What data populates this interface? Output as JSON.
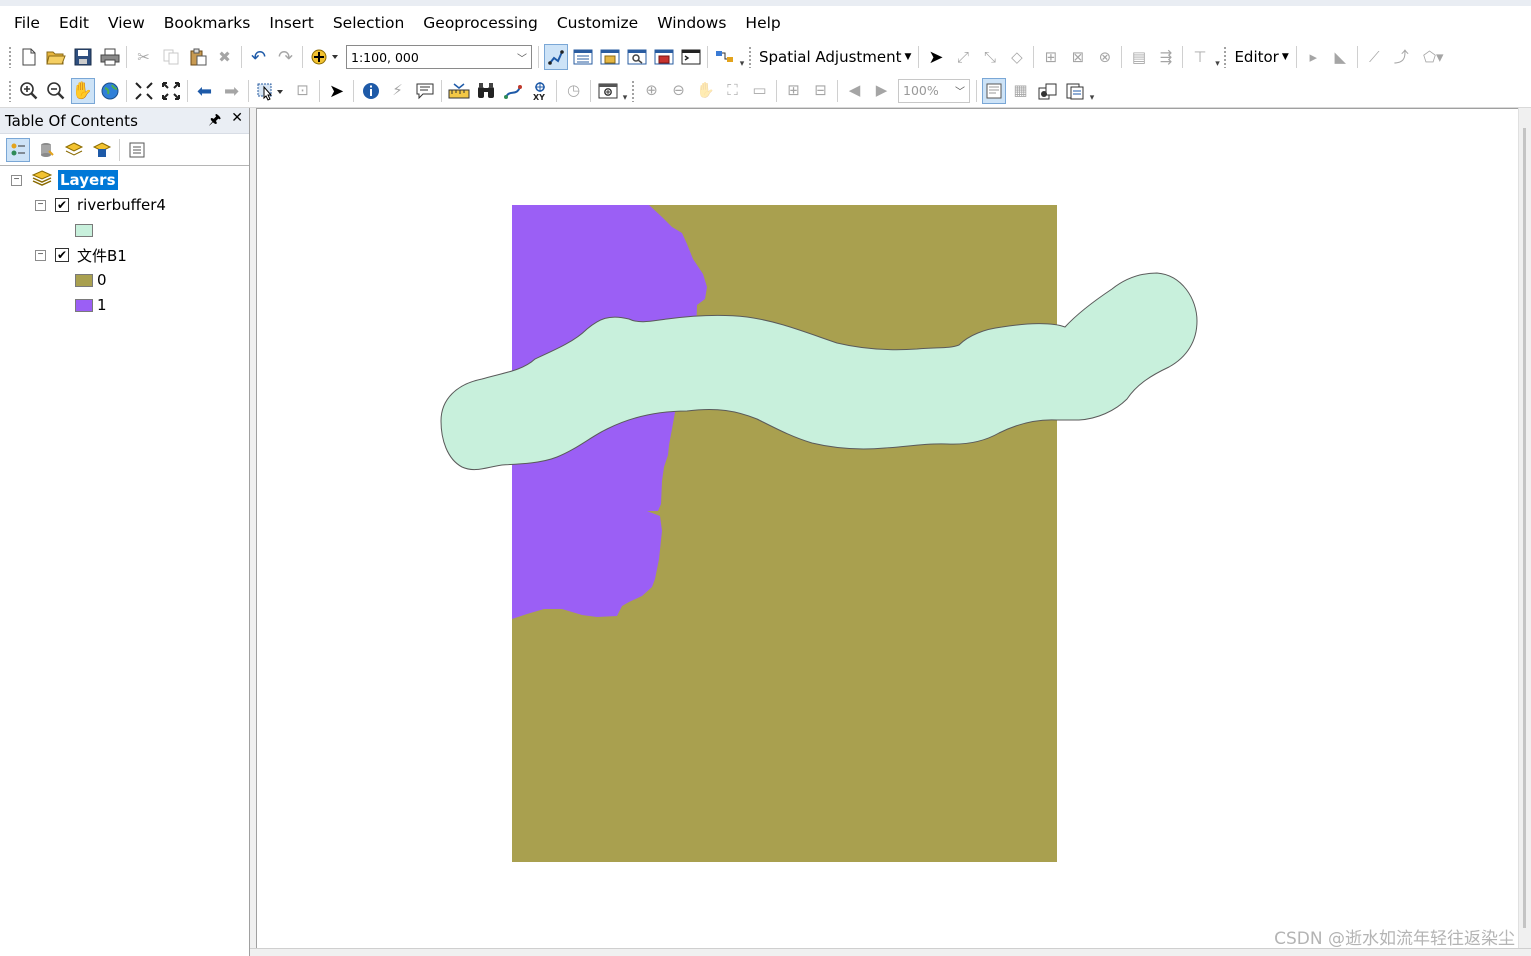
{
  "menubar": {
    "items": [
      "File",
      "Edit",
      "View",
      "Bookmarks",
      "Insert",
      "Selection",
      "Geoprocessing",
      "Customize",
      "Windows",
      "Help"
    ]
  },
  "toolbar_standard": {
    "scale_value": "1:100, 000",
    "spatial_adjustment_label": "Spatial Adjustment",
    "editor_label": "Editor"
  },
  "toolbar_layout": {
    "zoom_percent": "100%"
  },
  "toc": {
    "title": "Table Of Contents",
    "pin_glyph": "🖈",
    "close_glyph": "✕",
    "root_label": "Layers",
    "layers": [
      {
        "name": "riverbuffer4",
        "checked": true,
        "legend": [
          {
            "label": "",
            "color": "#c8f0dc"
          }
        ]
      },
      {
        "name": "文件B1",
        "checked": true,
        "legend": [
          {
            "label": "0",
            "color": "#a9a04f"
          },
          {
            "label": "1",
            "color": "#9b5ff5"
          }
        ]
      }
    ]
  },
  "map": {
    "colors": {
      "class0": "#a9a04f",
      "class1": "#9b5ff5",
      "buffer": "#c8f0dc",
      "outline": "#5a5a5a"
    }
  },
  "watermark": "CSDN @逝水如流年轻往返染尘"
}
